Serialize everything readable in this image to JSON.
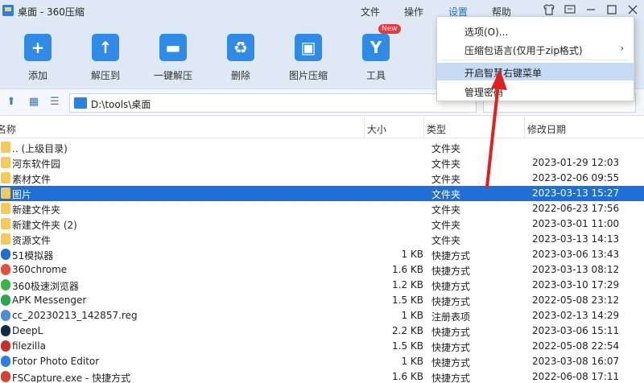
{
  "titlebar": {
    "title": "桌面 - 360压缩",
    "menu": [
      {
        "label": "文件"
      },
      {
        "label": "操作"
      },
      {
        "label": "设置",
        "active": true
      },
      {
        "label": "帮助"
      }
    ],
    "controls": [
      "shirt-icon",
      "message-icon",
      "minimize-icon",
      "maximize-icon",
      "close-icon"
    ]
  },
  "toolbar": {
    "tools": [
      {
        "label": "添加",
        "icon": "add-icon",
        "glyph": "+"
      },
      {
        "label": "解压到",
        "icon": "extract-to-icon",
        "glyph": "↑"
      },
      {
        "label": "一键解压",
        "icon": "one-click-extract-icon",
        "glyph": "▬"
      },
      {
        "label": "删除",
        "icon": "delete-icon",
        "glyph": "♻"
      },
      {
        "label": "图片压缩",
        "icon": "image-compress-icon",
        "glyph": "▣"
      },
      {
        "label": "工具",
        "icon": "tools-icon",
        "glyph": "Y"
      }
    ],
    "new_badge": "New"
  },
  "address": {
    "path": "D:\\tools\\桌面"
  },
  "columns": {
    "name": "名称",
    "size": "大小",
    "type": "类型",
    "modified": "修改日期"
  },
  "files": [
    {
      "name": ".. (上级目录)",
      "size": "",
      "type": "文件夹",
      "date": "",
      "icon": "folder",
      "color": "#f6c95c"
    },
    {
      "name": "河东软件园",
      "size": "",
      "type": "文件夹",
      "date": "2023-01-29 12:03",
      "icon": "folder",
      "color": "#f6c95c"
    },
    {
      "name": "素材文件",
      "size": "",
      "type": "文件夹",
      "date": "2023-02-06 09:55",
      "icon": "folder",
      "color": "#f6c95c"
    },
    {
      "name": "图片",
      "size": "",
      "type": "文件夹",
      "date": "2023-03-13 15:27",
      "icon": "folder",
      "color": "#f6c95c",
      "selected": true
    },
    {
      "name": "新建文件夹",
      "size": "",
      "type": "文件夹",
      "date": "2022-06-23 17:56",
      "icon": "folder",
      "color": "#f6c95c"
    },
    {
      "name": "新建文件夹 (2)",
      "size": "",
      "type": "文件夹",
      "date": "2023-03-01 11:00",
      "icon": "folder",
      "color": "#f6c95c"
    },
    {
      "name": "资源文件",
      "size": "",
      "type": "文件夹",
      "date": "2023-03-13 14:13",
      "icon": "folder",
      "color": "#f6c95c"
    },
    {
      "name": "51模拟器",
      "size": "1 KB",
      "type": "快捷方式",
      "date": "2023-03-06 13:43",
      "icon": "app",
      "color": "#1d6fd1"
    },
    {
      "name": "360chrome",
      "size": "1.6 KB",
      "type": "快捷方式",
      "date": "2023-03-13 08:12",
      "icon": "app",
      "color": "#e5503a"
    },
    {
      "name": "360极速浏览器",
      "size": "1.2 KB",
      "type": "快捷方式",
      "date": "2023-03-10 17:29",
      "icon": "app",
      "color": "#3bb34a"
    },
    {
      "name": "APK Messenger",
      "size": "1.5 KB",
      "type": "快捷方式",
      "date": "2022-05-08 23:12",
      "icon": "app",
      "color": "#2aa84a"
    },
    {
      "name": "cc_20230213_142857.reg",
      "size": "1 KB",
      "type": "注册表项",
      "date": "2023-02-13 14:29",
      "icon": "app",
      "color": "#4a8fd8"
    },
    {
      "name": "DeepL",
      "size": "2.2 KB",
      "type": "快捷方式",
      "date": "2023-03-06 15:11",
      "icon": "app",
      "color": "#0f2b46"
    },
    {
      "name": "filezilla",
      "size": "1.5 KB",
      "type": "快捷方式",
      "date": "2022-05-08 22:54",
      "icon": "app",
      "color": "#c9302c"
    },
    {
      "name": "Fotor Photo Editor",
      "size": "1 KB",
      "type": "快捷方式",
      "date": "2023-03-08 16:07",
      "icon": "app",
      "color": "#2a7de1"
    },
    {
      "name": "FSCapture.exe - 快捷方式",
      "size": "1.6 KB",
      "type": "快捷方式",
      "date": "2022-06-08 17:11",
      "icon": "app",
      "color": "#d4432f"
    }
  ],
  "dropdown": {
    "items": [
      {
        "label": "选项(O)..."
      },
      {
        "label": "压缩包语言(仅用于zip格式)",
        "submenu": true
      },
      {
        "label": "开启智慧右键菜单",
        "highlight": true
      },
      {
        "label": "管理密码"
      }
    ],
    "submenu_arrow": "›"
  },
  "colors": {
    "accent": "#1f6fd6",
    "chrome": "#dfe9f5",
    "annotation": "#e02020"
  }
}
